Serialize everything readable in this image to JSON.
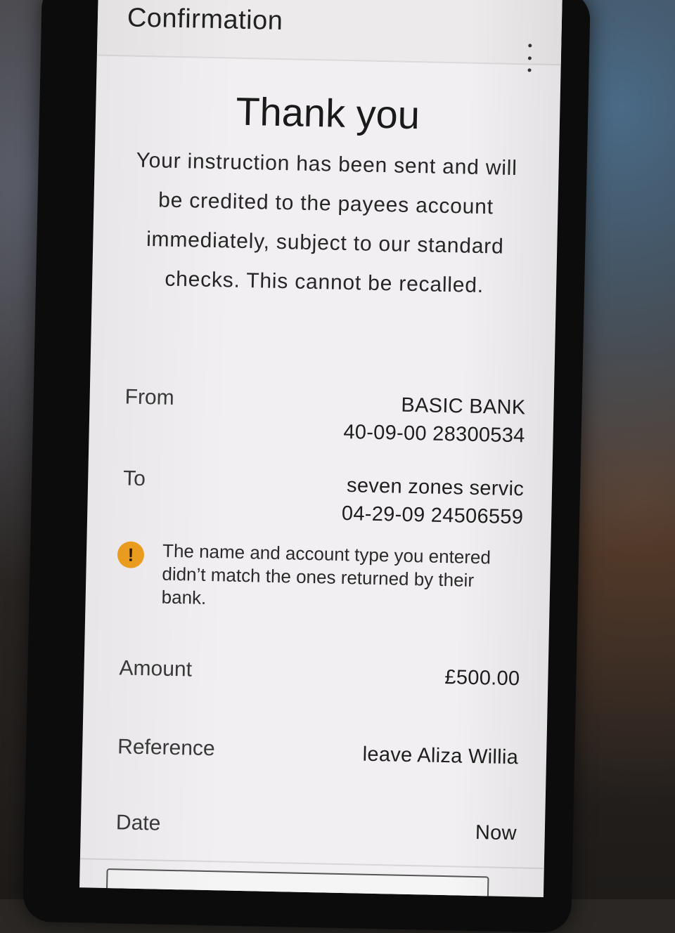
{
  "appbar": {
    "title": "Confirmation",
    "menu_icon": "more-vertical-icon"
  },
  "confirmation": {
    "heading": "Thank you",
    "message": "Your instruction has been sent and will be credited to the payees account immediately, subject to our standard checks.  This cannot be recalled."
  },
  "details": {
    "from": {
      "label": "From",
      "name": "BASIC BANK",
      "account": "40-09-00 28300534"
    },
    "to": {
      "label": "To",
      "name": "seven zones servic",
      "account": "04-29-09 24506559"
    },
    "warning": {
      "icon": "warning-icon",
      "symbol": "!",
      "text": "The name and account type you entered didn’t match the ones returned by their bank.",
      "color": "#f0a020"
    },
    "amount": {
      "label": "Amount",
      "value": "£500.00"
    },
    "reference": {
      "label": "Reference",
      "value": "leave Aliza Willia"
    },
    "date": {
      "label": "Date",
      "value": "Now"
    }
  }
}
